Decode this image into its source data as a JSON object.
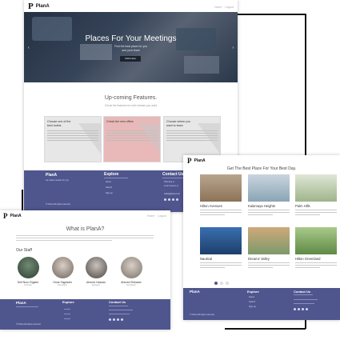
{
  "brand": {
    "name": "PlanA"
  },
  "home": {
    "nav": [
      "Home",
      "Logout"
    ],
    "hero": {
      "title": "Places For Your Meetings",
      "subtitle_1": "Find the best place for you",
      "subtitle_2": "and your team",
      "button": "Click Here"
    },
    "features": {
      "title": "Up-coming Features.",
      "subtitle": "Check the features for next release you want",
      "cards": [
        {
          "title": "Choose one of the best hotels"
        },
        {
          "title": "Check the new offers"
        },
        {
          "title": "Choose where you want to team"
        }
      ]
    },
    "footer": {
      "brand": "PlanA",
      "tagline": "we make it easier for you",
      "explore_title": "Explore",
      "explore_items": [
        "Home",
        "Search",
        "Sign up"
      ],
      "contact_title": "Contact Us",
      "contact_lines": [
        "Planning is ...",
        "Lorem ipsum st.",
        "...",
        "hello@plana.com"
      ],
      "copyright": "© PlanA All rights reserved"
    }
  },
  "places": {
    "title": "Get The Best Place For Your Best Day.",
    "items": [
      {
        "name": "Hilton Avenues"
      },
      {
        "name": "Kalamaya Heights"
      },
      {
        "name": "Palm Hills"
      },
      {
        "name": "Nautical"
      },
      {
        "name": "Dreamz Valley"
      },
      {
        "name": "Hilton Greenland"
      }
    ],
    "footer": {
      "brand": "PlanA",
      "explore_title": "Explore",
      "explore_items": [
        "Home",
        "Search",
        "Sign up"
      ],
      "contact_title": "Contact Us",
      "copyright": "© PlanA All rights reserved"
    }
  },
  "about": {
    "title": "What is PlanA?",
    "staff_title": "Our Staff",
    "staff": [
      {
        "name": "Seif Nour Elgabri",
        "role": "Founder"
      },
      {
        "name": "Omar Tageddin",
        "role": "Developer"
      },
      {
        "name": "Ahmed Hassan",
        "role": "Designer"
      },
      {
        "name": "Ahmed Elshaker",
        "role": "Developer"
      }
    ],
    "footer": {
      "brand": "PlanA",
      "explore_title": "Explore",
      "contact_title": "Contact Us",
      "copyright": "© PlanA All rights reserved"
    }
  },
  "colors": {
    "footer": "#4f568d",
    "accent": "#4f568d",
    "feature_highlight": "#e8b9b8"
  }
}
